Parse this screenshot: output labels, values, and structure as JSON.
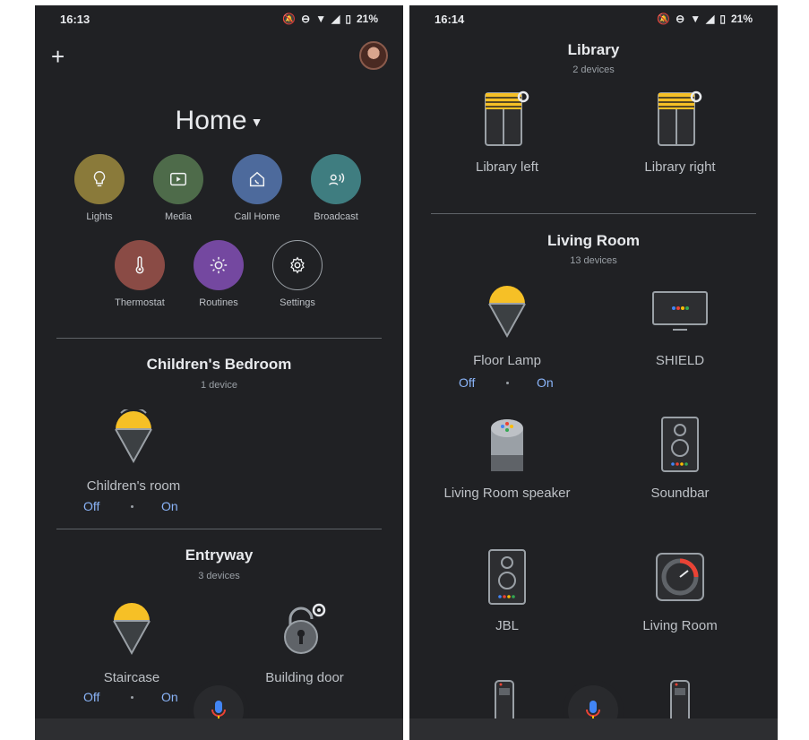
{
  "left": {
    "status": {
      "time": "16:13",
      "battery": "21%"
    },
    "home": {
      "title": "Home"
    },
    "shortcuts": [
      {
        "label": "Lights",
        "icon": "lightbulb-icon",
        "color": "#8a7a3a"
      },
      {
        "label": "Media",
        "icon": "media-icon",
        "color": "#4e6b4a"
      },
      {
        "label": "Call Home",
        "icon": "call-home-icon",
        "color": "#4d6a9c"
      },
      {
        "label": "Broadcast",
        "icon": "broadcast-icon",
        "color": "#3f7d80"
      },
      {
        "label": "Thermostat",
        "icon": "thermometer-icon",
        "color": "#8a4b45"
      },
      {
        "label": "Routines",
        "icon": "routines-icon",
        "color": "#7448a0"
      },
      {
        "label": "Settings",
        "icon": "gear-icon",
        "color": "#202124"
      }
    ],
    "rooms": [
      {
        "title": "Children's Bedroom",
        "count": "1 device",
        "devices": [
          {
            "name": "Children's room",
            "off": "Off",
            "on": "On"
          }
        ]
      },
      {
        "title": "Entryway",
        "count": "3 devices",
        "devices": [
          {
            "name": "Staircase",
            "off": "Off",
            "on": "On"
          },
          {
            "name": "Building door"
          }
        ]
      }
    ]
  },
  "right": {
    "status": {
      "time": "16:14",
      "battery": "21%"
    },
    "rooms": [
      {
        "title": "Library",
        "count": "2 devices",
        "devices": [
          {
            "name": "Library left"
          },
          {
            "name": "Library right"
          }
        ]
      },
      {
        "title": "Living Room",
        "count": "13 devices",
        "devices": [
          {
            "name": "Floor Lamp",
            "off": "Off",
            "on": "On"
          },
          {
            "name": "SHIELD"
          },
          {
            "name": "Living Room speaker"
          },
          {
            "name": "Soundbar"
          },
          {
            "name": "JBL"
          },
          {
            "name": "Living Room"
          }
        ]
      }
    ]
  },
  "colors": {
    "background": "#202124",
    "text": "#e8eaed",
    "accent": "#8ab4f8",
    "bulb": "#f6c026"
  }
}
